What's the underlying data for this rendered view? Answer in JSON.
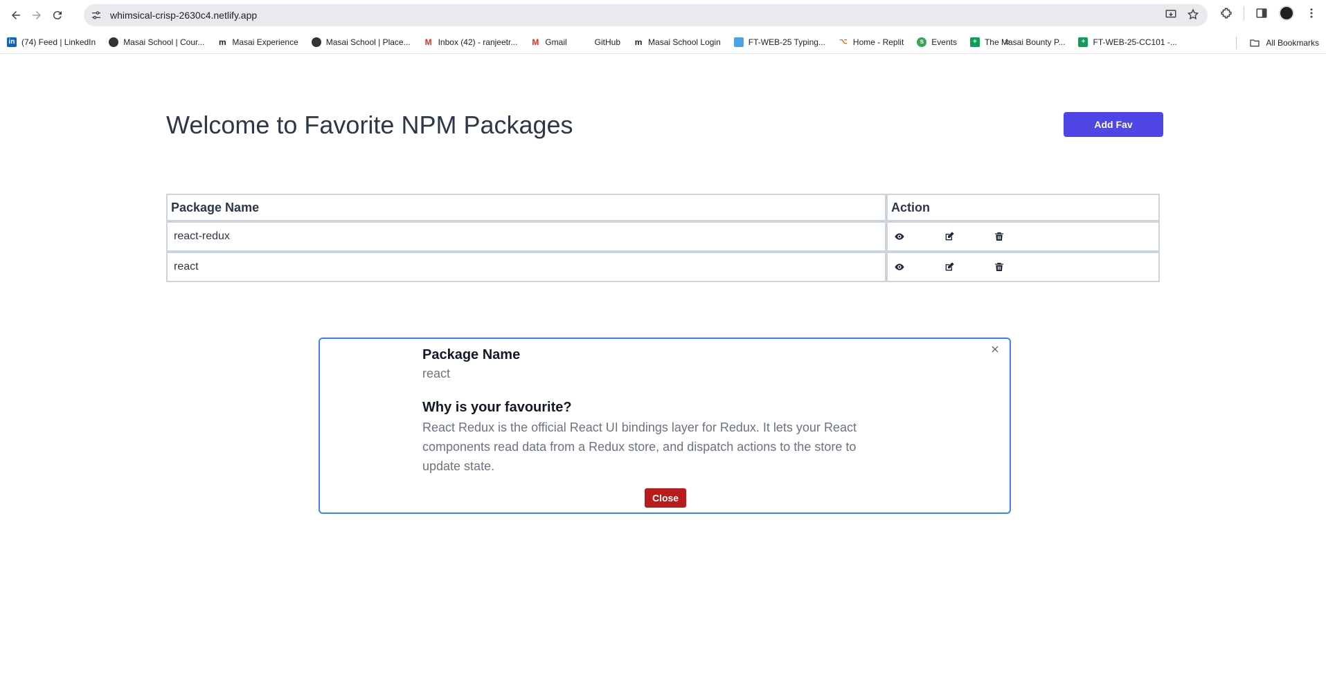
{
  "browser": {
    "url": "whimsical-crisp-2630c4.netlify.app",
    "bookmarks": [
      {
        "label": "(74) Feed | LinkedIn",
        "icon": "linkedin-icon"
      },
      {
        "label": "Masai School | Cour...",
        "icon": "globe-icon"
      },
      {
        "label": "Masai Experience",
        "icon": "masai-icon"
      },
      {
        "label": "Masai School | Place...",
        "icon": "globe-icon"
      },
      {
        "label": "Inbox (42) - ranjeetr...",
        "icon": "gmail-icon"
      },
      {
        "label": "Gmail",
        "icon": "gmail-icon"
      },
      {
        "label": "GitHub",
        "icon": "github-icon"
      },
      {
        "label": "Masai School Login",
        "icon": "masai-icon"
      },
      {
        "label": "FT-WEB-25 Typing...",
        "icon": "typing-icon"
      },
      {
        "label": "Home - Replit",
        "icon": "replit-icon"
      },
      {
        "label": "Events",
        "icon": "events-icon"
      },
      {
        "label": "The Masai Bounty P...",
        "icon": "sheets-icon"
      },
      {
        "label": "FT-WEB-25-CC101 -...",
        "icon": "sheets-icon"
      }
    ],
    "more_label": "»",
    "all_bookmarks_label": "All Bookmarks"
  },
  "page": {
    "title": "Welcome to Favorite NPM Packages",
    "add_button": "Add Fav"
  },
  "table": {
    "headers": [
      "Package Name",
      "Action"
    ],
    "rows": [
      {
        "name": "react-redux"
      },
      {
        "name": "react"
      }
    ]
  },
  "modal": {
    "name_label": "Package Name",
    "name_value": "react",
    "why_label": "Why is your favourite?",
    "why_value": "React Redux is the official React UI bindings layer for Redux. It lets your React components read data from a Redux store, and dispatch actions to the store to update state.",
    "close_button": "Close"
  }
}
